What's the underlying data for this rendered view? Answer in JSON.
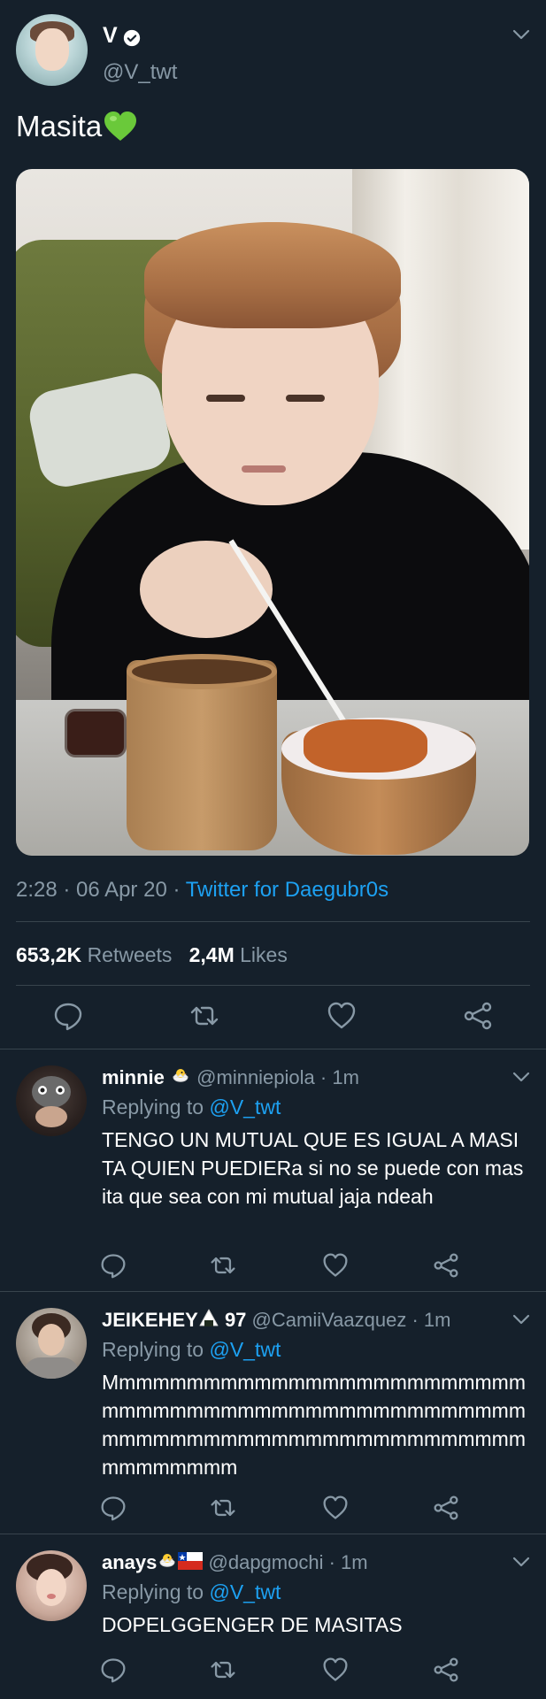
{
  "main_tweet": {
    "display_name": "V",
    "handle": "@V_twt",
    "text": "Masita",
    "timestamp": "2:28 · 06 Apr 20 · ",
    "source": "Twitter for Daegubr0s",
    "retweets_count": "653,2K",
    "retweets_label": "Retweets",
    "likes_count": "2,4M",
    "likes_label": "Likes",
    "icons": [
      "verified-badge",
      "green-heart-emoji",
      "chevron-down",
      "reply",
      "retweet",
      "like",
      "share"
    ]
  },
  "replies": [
    {
      "name": "minnie",
      "handle": "@minniepiola",
      "time": "· 1m",
      "replying_prefix": "Replying to",
      "replying_to": "@V_twt",
      "text": "TENGO UN MUTUAL QUE ES IGUAL A MASITA QUIEN PUEDIERa si no se puede con masita que sea con mi mutual jaja ndeah"
    },
    {
      "name": "JEIKEHEY",
      "name_suffix": " 97",
      "handle": "@CamiiVaazquez",
      "time": "· 1m",
      "replying_prefix": "Replying to",
      "replying_to": "@V_twt",
      "text": "Mmmmmmmmmmmmmmmmmmmmmmmmmmmmmmmmmmmmmmmmmmmmmmmmmmmmmmmmmmmmmmmmmmmmmmmmmmmmmmmmmmm"
    },
    {
      "name": "anays",
      "handle": "@dapgmochi",
      "time": "· 1m",
      "replying_prefix": "Replying to",
      "replying_to": "@V_twt",
      "text": "DOPELGGENGER DE MASITAS"
    }
  ],
  "colors": {
    "background": "#15202b",
    "divider": "#38444d",
    "muted": "#8899a6",
    "link": "#1da1f2"
  }
}
